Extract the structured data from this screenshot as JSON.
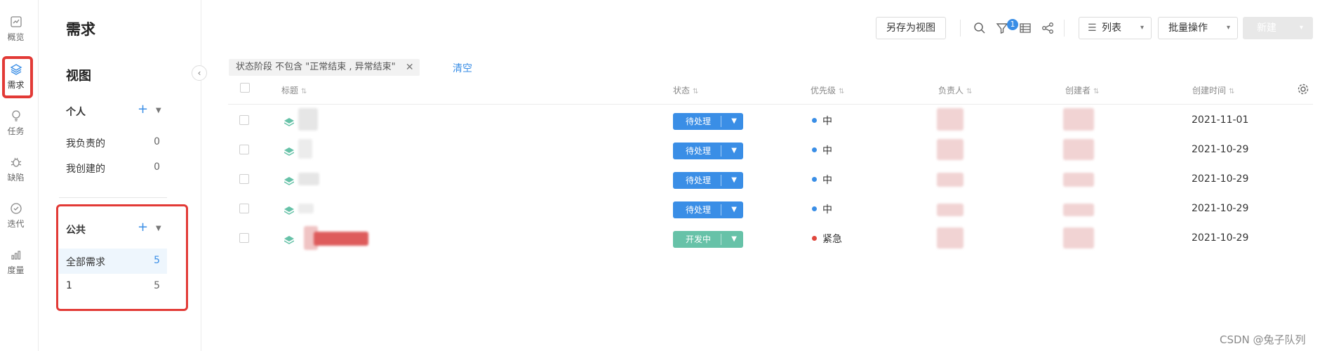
{
  "rail": {
    "items": [
      {
        "label": "概览",
        "icon": "overview-chart-icon"
      },
      {
        "label": "需求",
        "icon": "layers-icon"
      },
      {
        "label": "任务",
        "icon": "lightbulb-icon"
      },
      {
        "label": "缺陷",
        "icon": "bug-icon"
      },
      {
        "label": "迭代",
        "icon": "check-circle-icon"
      },
      {
        "label": "度量",
        "icon": "bar-chart-icon"
      }
    ],
    "active": "需求"
  },
  "page": {
    "title": "需求"
  },
  "views": {
    "title": "视图",
    "personal": {
      "label": "个人",
      "items": [
        {
          "label": "我负责的",
          "count": "0"
        },
        {
          "label": "我创建的",
          "count": "0"
        }
      ]
    },
    "public": {
      "label": "公共",
      "items": [
        {
          "label": "全部需求",
          "count": "5"
        },
        {
          "label": "1",
          "count": "5"
        }
      ]
    }
  },
  "toolbar": {
    "save_view": "另存为视图",
    "filter_badge": "1",
    "list_view": "列表",
    "batch": "批量操作",
    "new": "新建"
  },
  "filter": {
    "chip": "状态阶段 不包含 \"正常结束 , 异常结束\"",
    "clear": "清空"
  },
  "table": {
    "columns": {
      "title": "标题",
      "status": "状态",
      "priority": "优先级",
      "assignee": "负责人",
      "creator": "创建者",
      "created": "创建时间"
    },
    "rows": [
      {
        "status": "待处理",
        "status_color": "#3a8ee6",
        "priority": "中",
        "priority_color": "#3a8ee6",
        "created": "2021-11-01"
      },
      {
        "status": "待处理",
        "status_color": "#3a8ee6",
        "priority": "中",
        "priority_color": "#3a8ee6",
        "created": "2021-10-29"
      },
      {
        "status": "待处理",
        "status_color": "#3a8ee6",
        "priority": "中",
        "priority_color": "#3a8ee6",
        "created": "2021-10-29"
      },
      {
        "status": "待处理",
        "status_color": "#3a8ee6",
        "priority": "中",
        "priority_color": "#3a8ee6",
        "created": "2021-10-29"
      },
      {
        "status": "开发中",
        "status_color": "#67c2a8",
        "priority": "紧急",
        "priority_color": "#e0473d",
        "created": "2021-10-29"
      }
    ]
  },
  "watermark": "CSDN @兔子队列"
}
